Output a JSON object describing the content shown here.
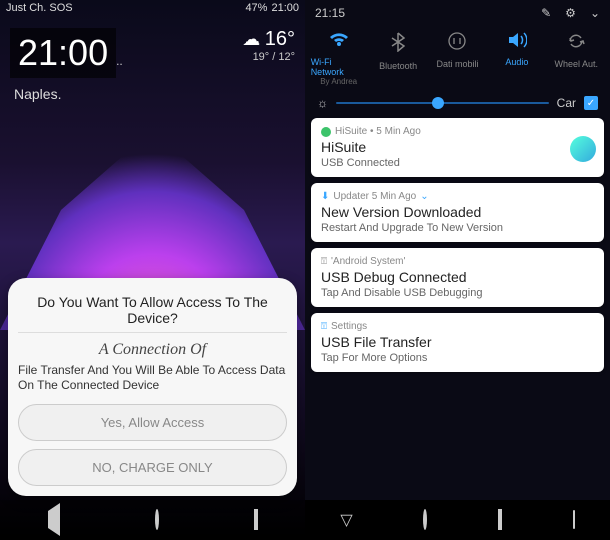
{
  "left": {
    "status": {
      "carrier": "Just Ch. SOS",
      "battery": "47%",
      "time": "21:00"
    },
    "clock": {
      "time": "21:00",
      "suffix": "..",
      "city": "Naples."
    },
    "weather": {
      "temp": "16°",
      "high_low": "19° / 12°"
    },
    "dialog": {
      "title": "Do You Want To Allow Access To The Device?",
      "subtitle": "A Connection Of",
      "body": "File Transfer And You Will Be Able To Access Data On The Connected Device",
      "btn_yes": "Yes, Allow Access",
      "btn_no": "NO, CHARGE ONLY"
    }
  },
  "right": {
    "status": {
      "time": "21:15"
    },
    "qs": {
      "tiles": [
        {
          "label": "Wi-Fi Network",
          "sub": "By Andrea",
          "active": true,
          "icon": "wifi"
        },
        {
          "label": "Bluetooth",
          "active": false,
          "icon": "bluetooth"
        },
        {
          "label": "Dati mobili",
          "active": false,
          "icon": "data"
        },
        {
          "label": "Audio",
          "active": true,
          "icon": "audio"
        },
        {
          "label": "Wheel Aut.",
          "active": false,
          "icon": "rotate"
        }
      ],
      "brightness_percent": 45,
      "auto_label": "Car"
    },
    "notifications": [
      {
        "app": "HiSuite",
        "meta": "HiSuite • 5 Min Ago",
        "title": "HiSuite",
        "body": "USB Connected",
        "badge": true
      },
      {
        "app": "Updater",
        "meta": "Updater 5 Min Ago",
        "title": "New Version Downloaded",
        "body": "Restart And Upgrade To New Version",
        "expandable": true
      },
      {
        "app": "Android System",
        "meta": "'Android System'",
        "title": "USB Debug Connected",
        "body": "Tap And Disable USB Debugging"
      },
      {
        "app": "Settings",
        "meta": "Settings",
        "title": "USB File Transfer",
        "body": "Tap For More Options"
      }
    ]
  }
}
